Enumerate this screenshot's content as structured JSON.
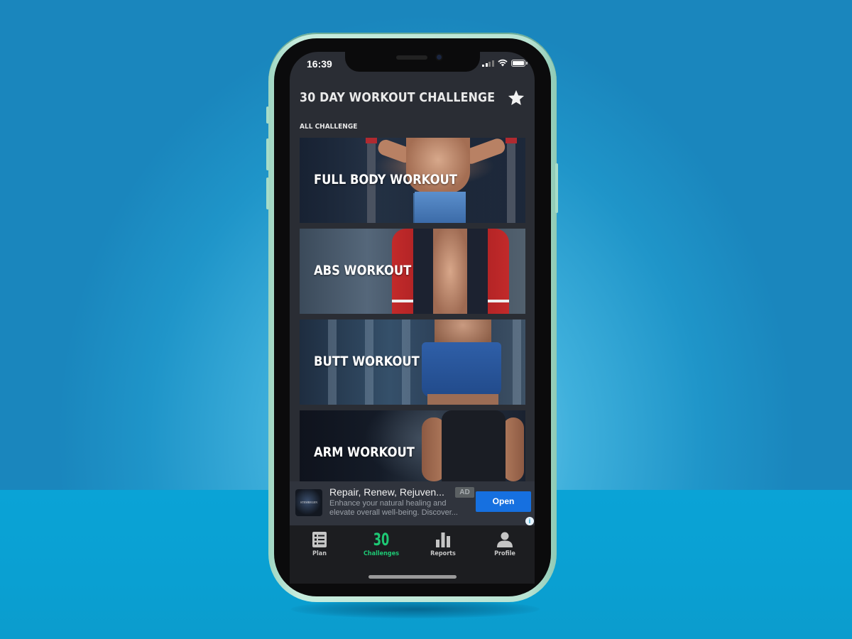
{
  "status_bar": {
    "time": "16:39",
    "signal_icon": "cellular-signal-icon",
    "wifi_icon": "wifi-icon",
    "battery_icon": "battery-icon"
  },
  "header": {
    "title": "30 DAY WORKOUT CHALLENGE",
    "favorite_icon": "star-icon"
  },
  "section_title": "ALL CHALLENGE",
  "challenges": [
    {
      "label": "FULL BODY WORKOUT"
    },
    {
      "label": "ABS WORKOUT"
    },
    {
      "label": "BUTT WORKOUT"
    },
    {
      "label": "ARM WORKOUT"
    }
  ],
  "ad": {
    "logo_text": "STEMREGEN",
    "title": "Repair, Renew, Rejuven...",
    "badge": "AD",
    "description": "Enhance your natural healing and elevate overall well-being. Discover...",
    "cta": "Open",
    "info_icon": "i"
  },
  "tabbar": {
    "items": [
      {
        "label": "Plan",
        "icon": "list-icon",
        "active": false
      },
      {
        "label": "Challenges",
        "icon_text": "30",
        "active": true
      },
      {
        "label": "Reports",
        "icon": "bar-chart-icon",
        "active": false
      },
      {
        "label": "Profile",
        "icon": "person-icon",
        "active": false
      }
    ]
  },
  "colors": {
    "accent": "#1ec874",
    "ad_button": "#1670e0",
    "screen_bg": "#2a2d34",
    "tabbar_bg": "#1c1d20"
  }
}
